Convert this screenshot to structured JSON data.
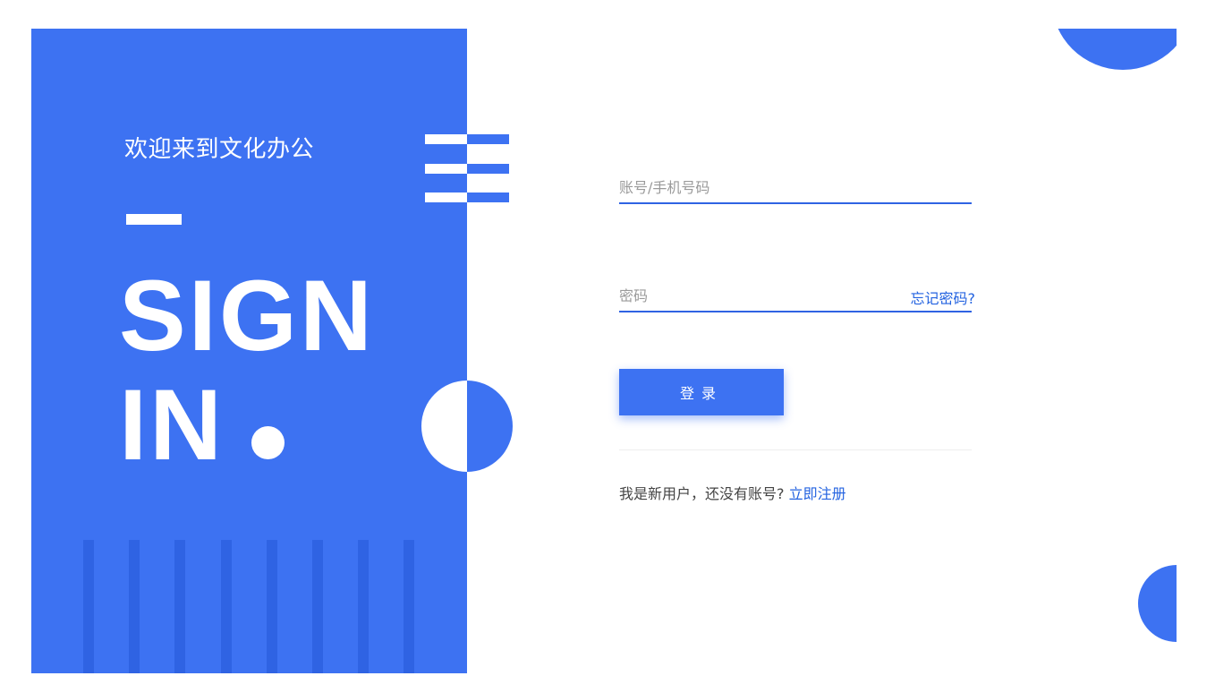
{
  "left_panel": {
    "welcome": "欢迎来到文化办公",
    "headline_line1": "SIGN",
    "headline_line2": "IN"
  },
  "form": {
    "account_placeholder": "账号/手机号码",
    "password_placeholder": "密码",
    "forgot_label": "忘记密码?",
    "login_label": "登录",
    "register_prompt": "我是新用户，还没有账号?",
    "register_link": "立即注册"
  },
  "colors": {
    "accent": "#3d72f2",
    "accent_dark": "#2f63e3",
    "link": "#2463e0",
    "placeholder": "#9a9a9a"
  }
}
